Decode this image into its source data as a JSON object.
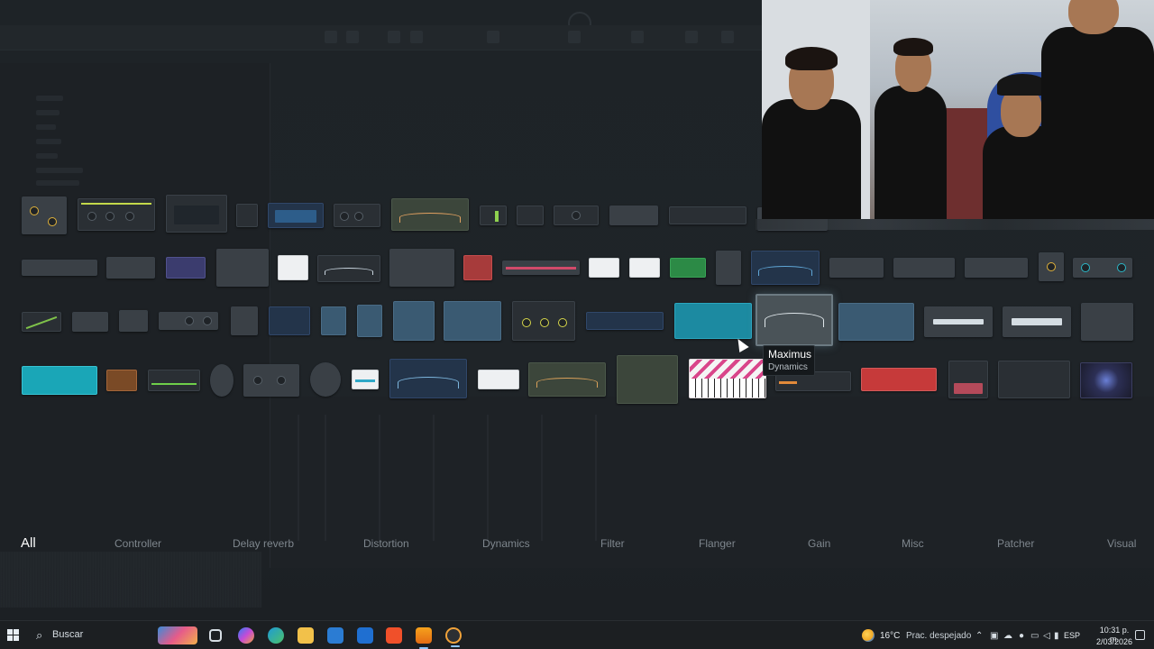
{
  "tooltip": {
    "title": "Maximus",
    "subtitle": "Dynamics"
  },
  "categories": [
    {
      "label": "All",
      "active": true
    },
    {
      "label": "Controller",
      "active": false
    },
    {
      "label": "Delay reverb",
      "active": false
    },
    {
      "label": "Distortion",
      "active": false
    },
    {
      "label": "Dynamics",
      "active": false
    },
    {
      "label": "Filter",
      "active": false
    },
    {
      "label": "Flanger",
      "active": false
    },
    {
      "label": "Gain",
      "active": false
    },
    {
      "label": "Misc",
      "active": false
    },
    {
      "label": "Patcher",
      "active": false
    },
    {
      "label": "Visual",
      "active": false
    }
  ],
  "plugin_grid": {
    "selected_plugin": "Maximus",
    "selected_category": "Dynamics"
  },
  "taskbar": {
    "search_placeholder": "Buscar",
    "apps": [
      "task-view",
      "copilot",
      "edge",
      "file-explorer",
      "microsoft-store",
      "outlook",
      "brave",
      "fl-studio",
      "recorder"
    ]
  },
  "tray": {
    "temperature": "16°C",
    "weather": "Prac. despejado",
    "language": "ESP",
    "time": "10:31 p. m.",
    "date": "2/03/2026"
  },
  "colors": {
    "background": "#1b1f23",
    "active_category": "#ffffff",
    "inactive_category": "#7e868d",
    "taskbar": "#1c1f22"
  }
}
